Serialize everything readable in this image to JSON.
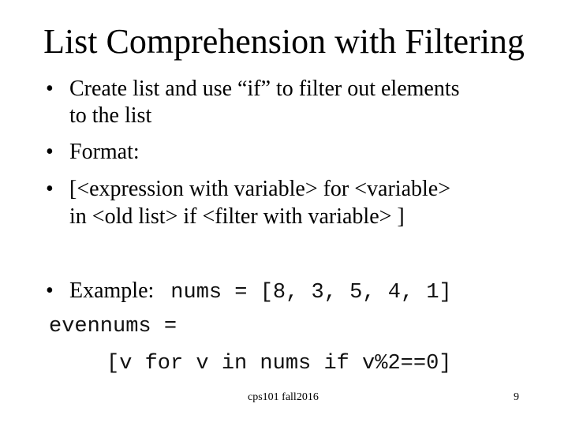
{
  "slide": {
    "title": "List Comprehension with Filtering",
    "bullet_glyph": "•",
    "bullets": [
      {
        "lines": [
          "Create list and use “if” to filter out elements",
          "to the list"
        ]
      },
      {
        "lines": [
          "Format:"
        ]
      },
      {
        "lines": [
          "[<expression with variable> for <variable>",
          "in <old list> if <filter with variable> ]"
        ]
      }
    ],
    "example": {
      "label": "Example:",
      "code_line1": "nums = [8, 3, 5, 4, 1]",
      "code_line2": "evennums =",
      "code_line3": "[v for v in nums if v%2==0]"
    },
    "footer": {
      "course": "cps101 fall2016",
      "page_number": "9"
    }
  }
}
